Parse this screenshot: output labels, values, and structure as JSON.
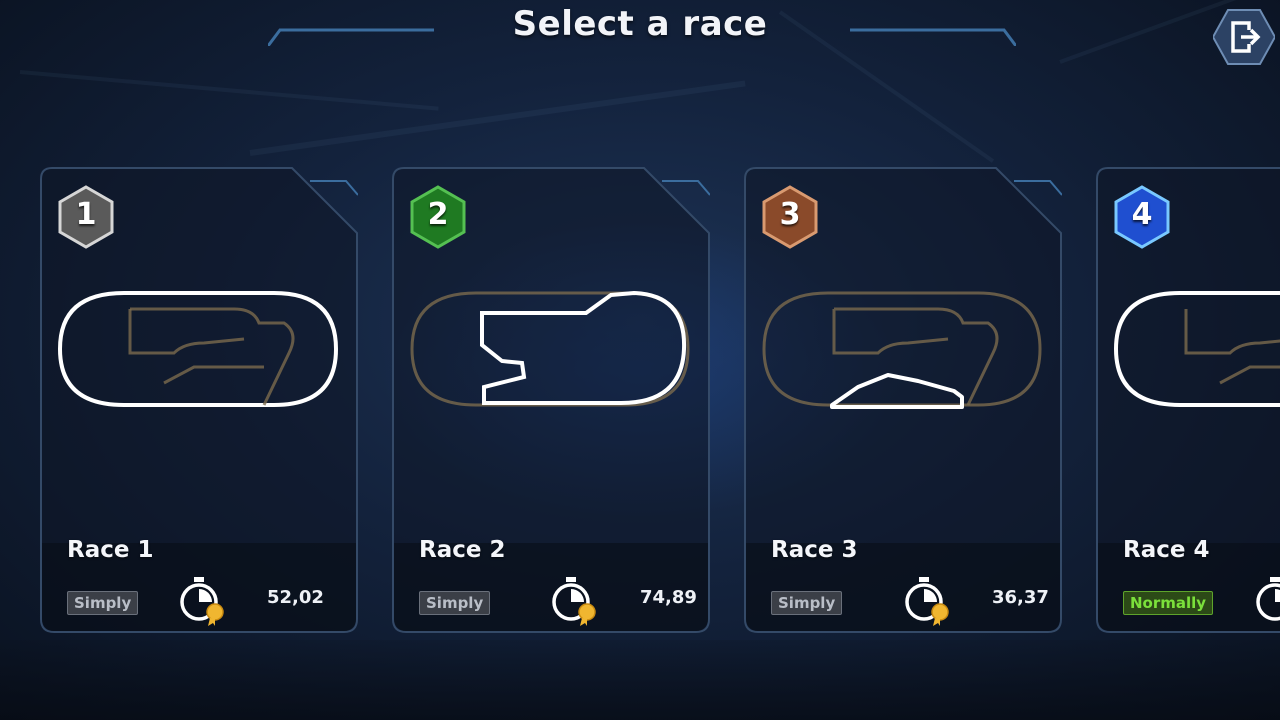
{
  "header": {
    "title": "Select a race"
  },
  "exit": {
    "icon": "exit-icon"
  },
  "races": [
    {
      "number": "1",
      "name": "Race 1",
      "difficulty": "Simply",
      "time": "52,02",
      "badge_color": "#5a5a5a",
      "difficulty_color": "#3b3f47"
    },
    {
      "number": "2",
      "name": "Race 2",
      "difficulty": "Simply",
      "time": "74,89",
      "badge_color": "#1f7a22",
      "difficulty_color": "#3b3f47"
    },
    {
      "number": "3",
      "name": "Race 3",
      "difficulty": "Simply",
      "time": "36,37",
      "badge_color": "#8a4a2a",
      "difficulty_color": "#3b3f47"
    },
    {
      "number": "4",
      "name": "Race 4",
      "difficulty": "Normally",
      "time": "",
      "badge_color": "#1f4fd0",
      "difficulty_color": "#2c4a17"
    }
  ],
  "icons": {
    "best_time": "stopwatch-medal-icon"
  },
  "colors": {
    "accent": "#4a7fb2",
    "highlight_track": "#ffffff",
    "normally_text": "#7be03b"
  }
}
